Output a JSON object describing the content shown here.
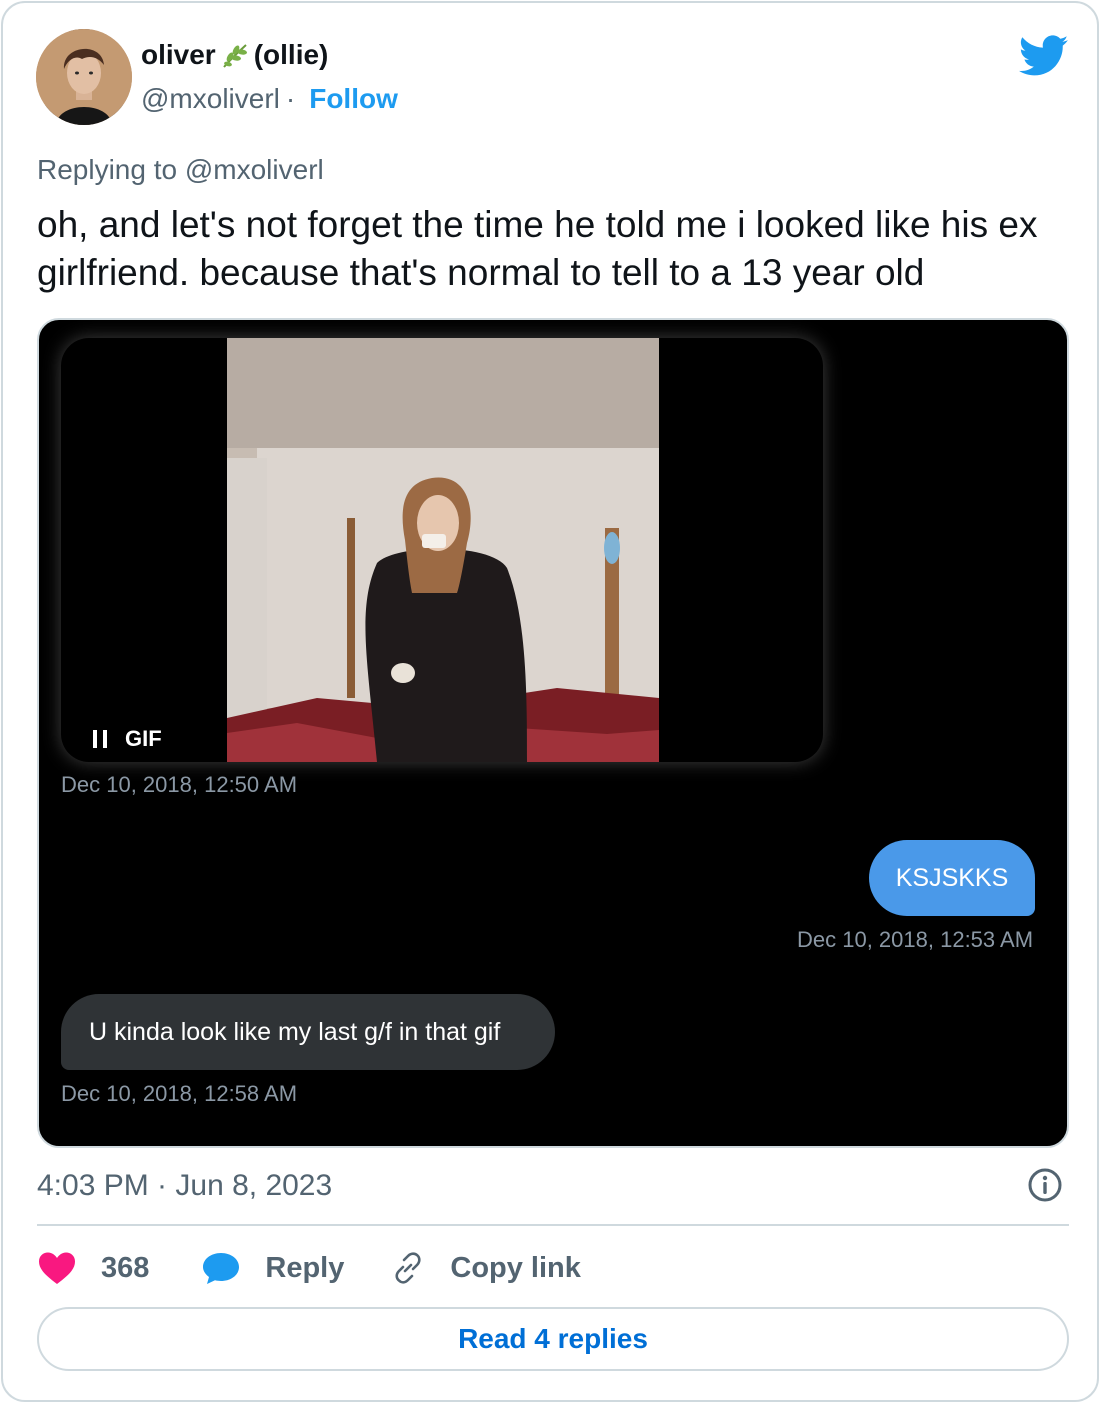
{
  "author": {
    "display_name_part1": "oliver",
    "name_emoji": "herb-icon",
    "display_name_part2": "(ollie)",
    "handle": "@mxoliverl",
    "separator": "·",
    "follow_label": "Follow"
  },
  "logo": "twitter-bird-icon",
  "replying_to": "Replying to @mxoliverl",
  "tweet_text": "oh, and let's not forget the time he told me i looked like his ex girlfriend. because that's normal to tell to a 13 year old",
  "media": {
    "gif_badge": "GIF",
    "messages": [
      {
        "type": "gif",
        "timestamp": "Dec 10, 2018, 12:50 AM"
      },
      {
        "type": "sent",
        "text": "KSJSKKS",
        "timestamp": "Dec 10, 2018, 12:53 AM"
      },
      {
        "type": "received",
        "text": "U kinda look like my last g/f in that gif",
        "timestamp": "Dec 10, 2018, 12:58 AM"
      }
    ]
  },
  "tweet_time": "4:03 PM · Jun 8, 2023",
  "actions": {
    "like_count": "368",
    "reply_label": "Reply",
    "copy_link_label": "Copy link"
  },
  "read_replies_label": "Read 4 replies",
  "colors": {
    "accent": "#1d9bf0",
    "like": "#f91880",
    "sent_bubble": "#4a99e9",
    "received_bubble": "#2f3336"
  }
}
